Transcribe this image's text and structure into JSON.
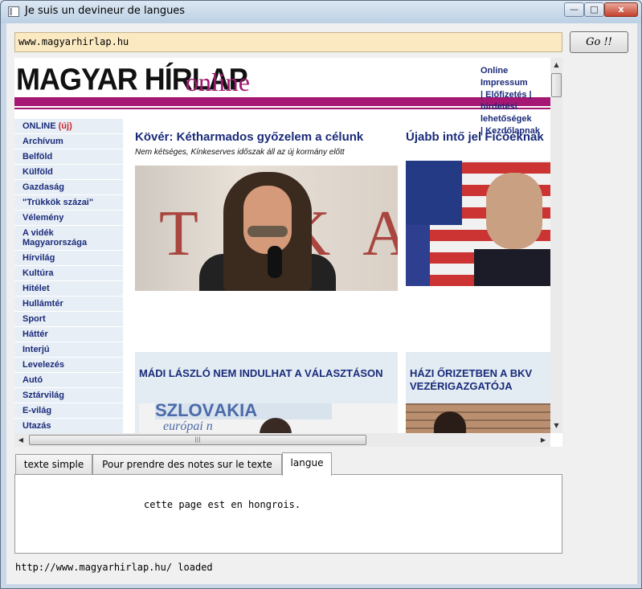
{
  "window": {
    "title": "Je suis un devineur de langues",
    "minimize": "—",
    "maximize": "□",
    "close": "x"
  },
  "toolbar": {
    "url_value": "www.magyarhirlap.hu",
    "go_label": "Go !!"
  },
  "webpage": {
    "logo_main": "MAGYAR HÍRLAP",
    "logo_online": "online",
    "top_links": [
      "Online",
      "Impressum",
      "| Előfizetés |",
      "hirdetési",
      "lehetőségek",
      "| Kezdőlapnak"
    ],
    "nav": [
      {
        "label": "ONLINE",
        "badge": "(új)"
      },
      {
        "label": "Archívum"
      },
      {
        "label": "Belföld"
      },
      {
        "label": "Külföld"
      },
      {
        "label": "Gazdaság"
      },
      {
        "label": "\"Trükkök százai\""
      },
      {
        "label": "Vélemény"
      },
      {
        "label": "A vidék Magyarországa"
      },
      {
        "label": "Hírvilág"
      },
      {
        "label": "Kultúra"
      },
      {
        "label": "Hitélet"
      },
      {
        "label": "Hullámtér"
      },
      {
        "label": "Sport"
      },
      {
        "label": "Háttér"
      },
      {
        "label": "Interjú"
      },
      {
        "label": "Levelezés"
      },
      {
        "label": "Autó"
      },
      {
        "label": "Sztárvilág"
      },
      {
        "label": "E-világ"
      },
      {
        "label": "Utazás"
      }
    ],
    "headline1": "Kövér: Kétharmados győzelem a célunk",
    "subhead1": "Nem kétséges, Kínkeserves időszak áll az új kormány előtt",
    "headline2": "Újabb intő jel Ficóéknak",
    "photo1_letters": "TIKA",
    "box1_headline": "MÁDI LÁSZLÓ NEM INDULHAT A VÁLASZTÁSON",
    "box1_banner": "SZLOVÁKIA",
    "box1_script": "európai n",
    "box2_headline": "HÁZI ŐRIZETBEN A BKV VEZÉRIGAZGATÓJA"
  },
  "tabs": [
    {
      "label": "texte simple"
    },
    {
      "label": "Pour prendre des notes sur le texte"
    },
    {
      "label": "langue"
    }
  ],
  "result_text": "cette page est en hongrois.",
  "status_text": "http://www.magyarhirlap.hu/ loaded"
}
